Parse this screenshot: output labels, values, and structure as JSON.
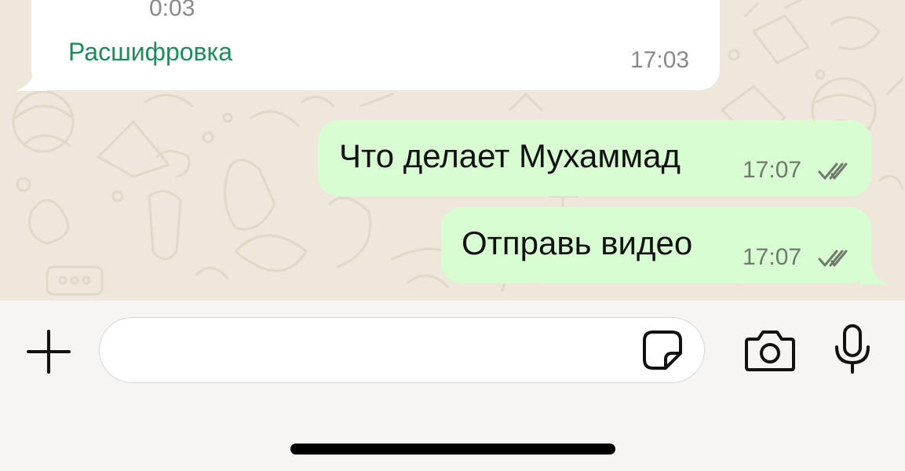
{
  "incoming_message": {
    "duration": "0:03",
    "transcribe_label": "Расшифровка",
    "time": "17:03"
  },
  "outgoing_messages": [
    {
      "text": "Что делает Мухаммад",
      "time": "17:07",
      "status_icon": "double-check-icon"
    },
    {
      "text": "Отправь видео",
      "time": "17:07",
      "status_icon": "double-check-icon"
    }
  ],
  "composer": {
    "input_value": "",
    "input_placeholder": "",
    "icons": [
      "plus-icon",
      "sticker-icon",
      "camera-icon",
      "microphone-icon"
    ]
  },
  "colors": {
    "outgoing_bubble": "#d9fdd3",
    "incoming_bubble": "#ffffff",
    "accent": "#1f8a5a",
    "wallpaper": "#efe7dc"
  }
}
